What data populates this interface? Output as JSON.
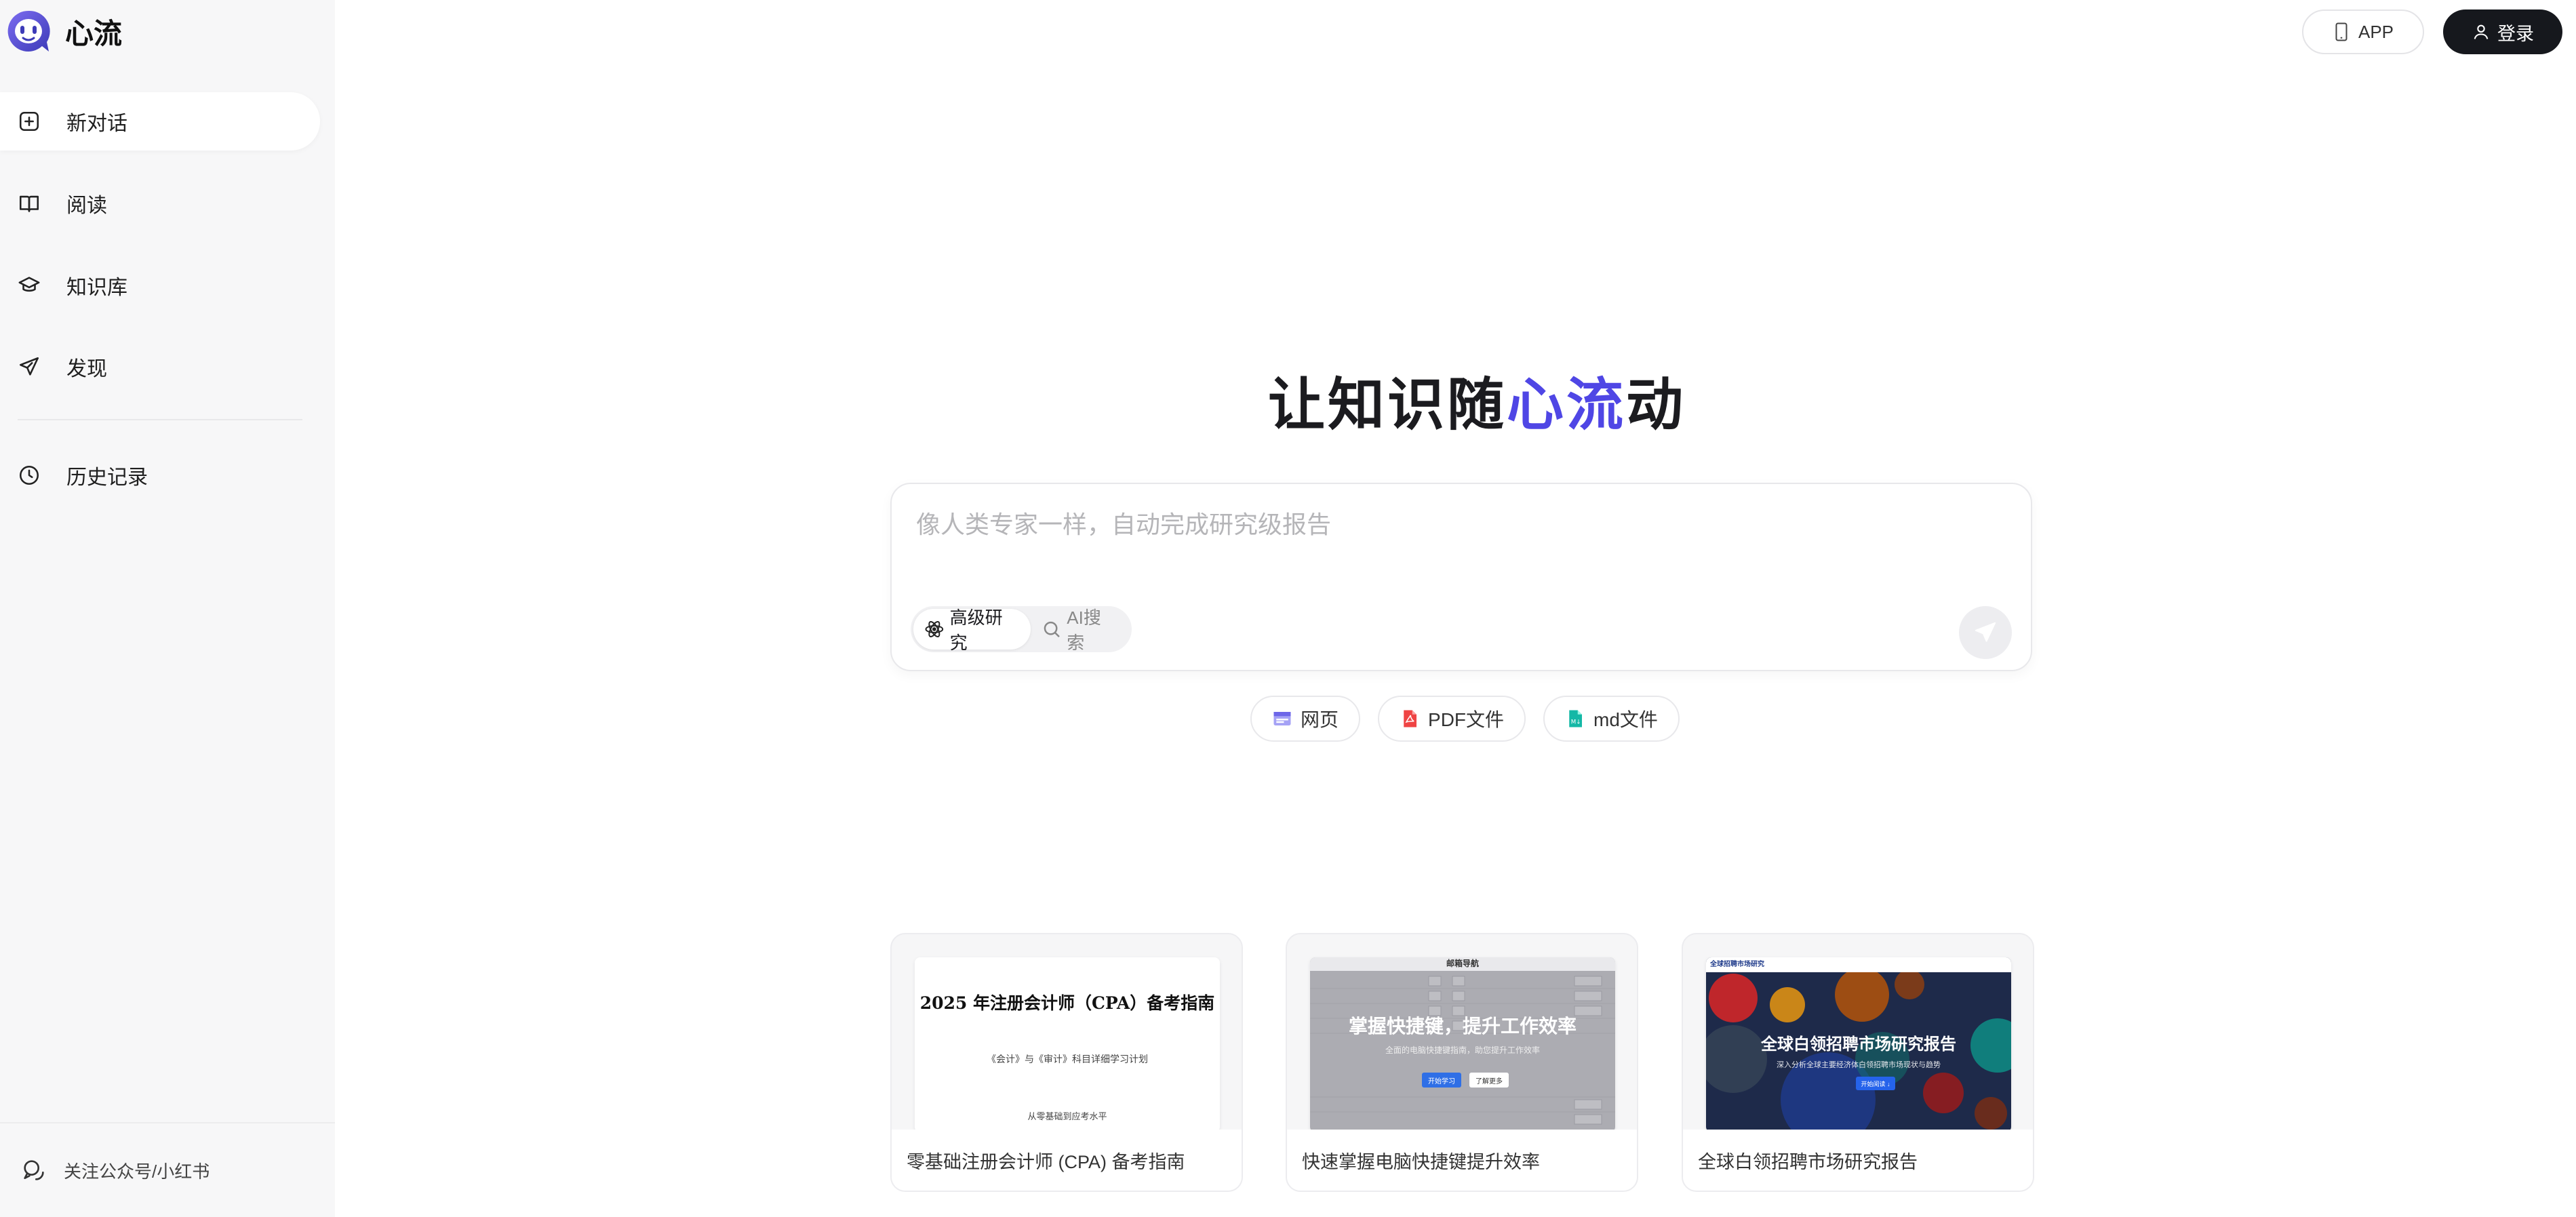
{
  "app": {
    "name": "心流"
  },
  "sidebar": {
    "items": [
      {
        "label": "新对话",
        "icon": "plus-square-icon",
        "active": true
      },
      {
        "label": "阅读",
        "icon": "book-open-icon",
        "active": false
      },
      {
        "label": "知识库",
        "icon": "graduation-cap-icon",
        "active": false
      },
      {
        "label": "发现",
        "icon": "send-icon",
        "active": false
      },
      {
        "label": "历史记录",
        "icon": "clock-icon",
        "active": false
      }
    ],
    "footer": {
      "label": "关注公众号/小红书",
      "icon": "chat-bubbles-icon"
    }
  },
  "header": {
    "app_label": "APP",
    "login_label": "登录"
  },
  "hero": {
    "title_pre": "让知识随",
    "title_accent": "心流",
    "title_post": "动",
    "accent_color": "#4f46e5"
  },
  "search": {
    "placeholder": "像人类专家一样，自动完成研究级报告",
    "value": "",
    "modes": [
      {
        "label": "高级研究",
        "icon": "atom-icon",
        "active": true
      },
      {
        "label": "AI搜索",
        "icon": "search-icon",
        "active": false
      }
    ],
    "send_icon": "send-icon"
  },
  "chips": [
    {
      "label": "网页",
      "icon": "web-page-icon"
    },
    {
      "label": "PDF文件",
      "icon": "pdf-file-icon"
    },
    {
      "label": "md文件",
      "icon": "md-file-icon"
    }
  ],
  "cards": [
    {
      "caption": "零基础注册会计师 (CPA) 备考指南",
      "thumb": {
        "title": "2025 年注册会计师（CPA）备考指南",
        "subtitle": "《会计》与《审计》科目详细学习计划",
        "note": "从零基础到应考水平"
      }
    },
    {
      "caption": "快速掌握电脑快捷键提升效率",
      "thumb": {
        "header": "邮箱导航",
        "title": "掌握快捷键，提升工作效率",
        "subtitle": "全面的电脑快捷键指南，助您提升工作效率",
        "primary_btn": "开始学习",
        "secondary_btn": "了解更多"
      }
    },
    {
      "caption": "全球白领招聘市场研究报告",
      "thumb": {
        "header": "全球招聘市场研究",
        "title": "全球白领招聘市场研究报告",
        "subtitle": "深入分析全球主要经济体白领招聘市场现状与趋势",
        "btn": "开始阅读 ↓"
      }
    }
  ]
}
